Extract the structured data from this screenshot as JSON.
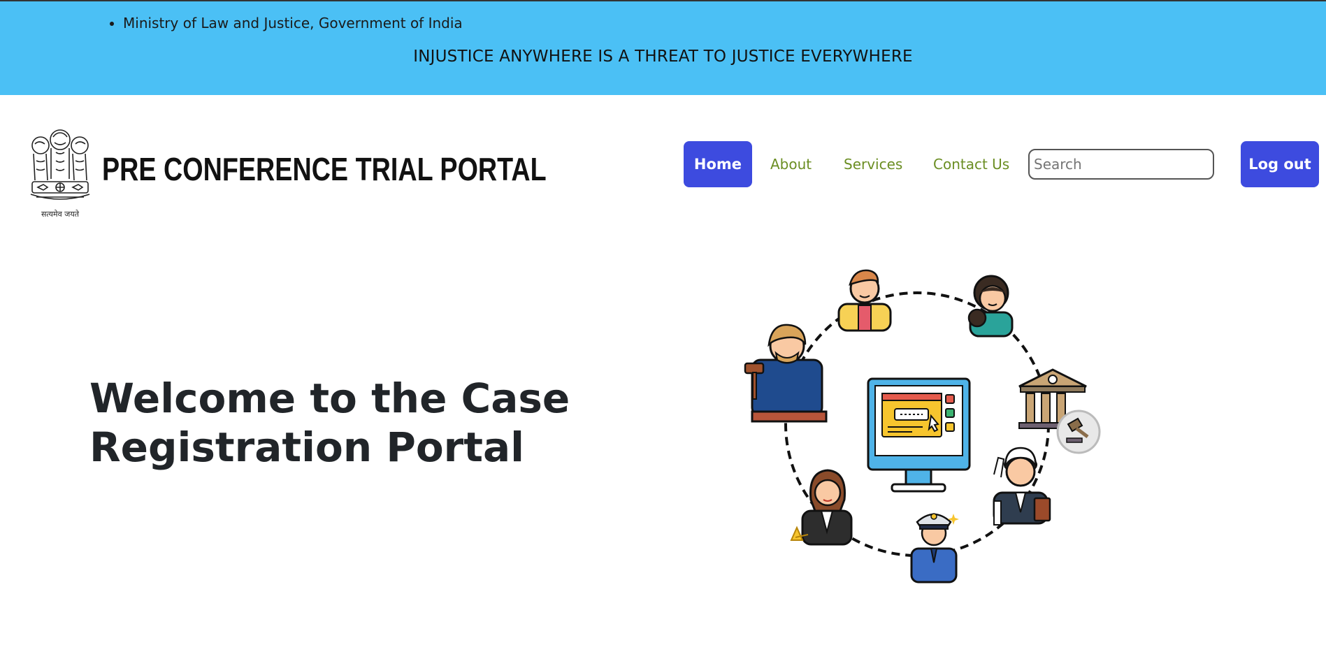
{
  "topbar": {
    "ministry": "Ministry of Law and Justice, Government of India",
    "tagline": "INJUSTICE ANYWHERE IS A THREAT TO JUSTICE EVERYWHERE"
  },
  "header": {
    "emblem_caption": "सत्यमेव जयते",
    "title": "PRE CONFERENCE TRIAL PORTAL"
  },
  "nav": {
    "home": "Home",
    "about": "About",
    "services": "Services",
    "contact": "Contact Us",
    "search_placeholder": "Search",
    "logout": "Log out"
  },
  "hero": {
    "line1": "Welcome to the Case",
    "line2": "Registration Portal"
  },
  "colors": {
    "topbar_bg": "#4bc0f5",
    "primary_button": "#3d4bdf",
    "nav_link": "#6b8e23"
  }
}
